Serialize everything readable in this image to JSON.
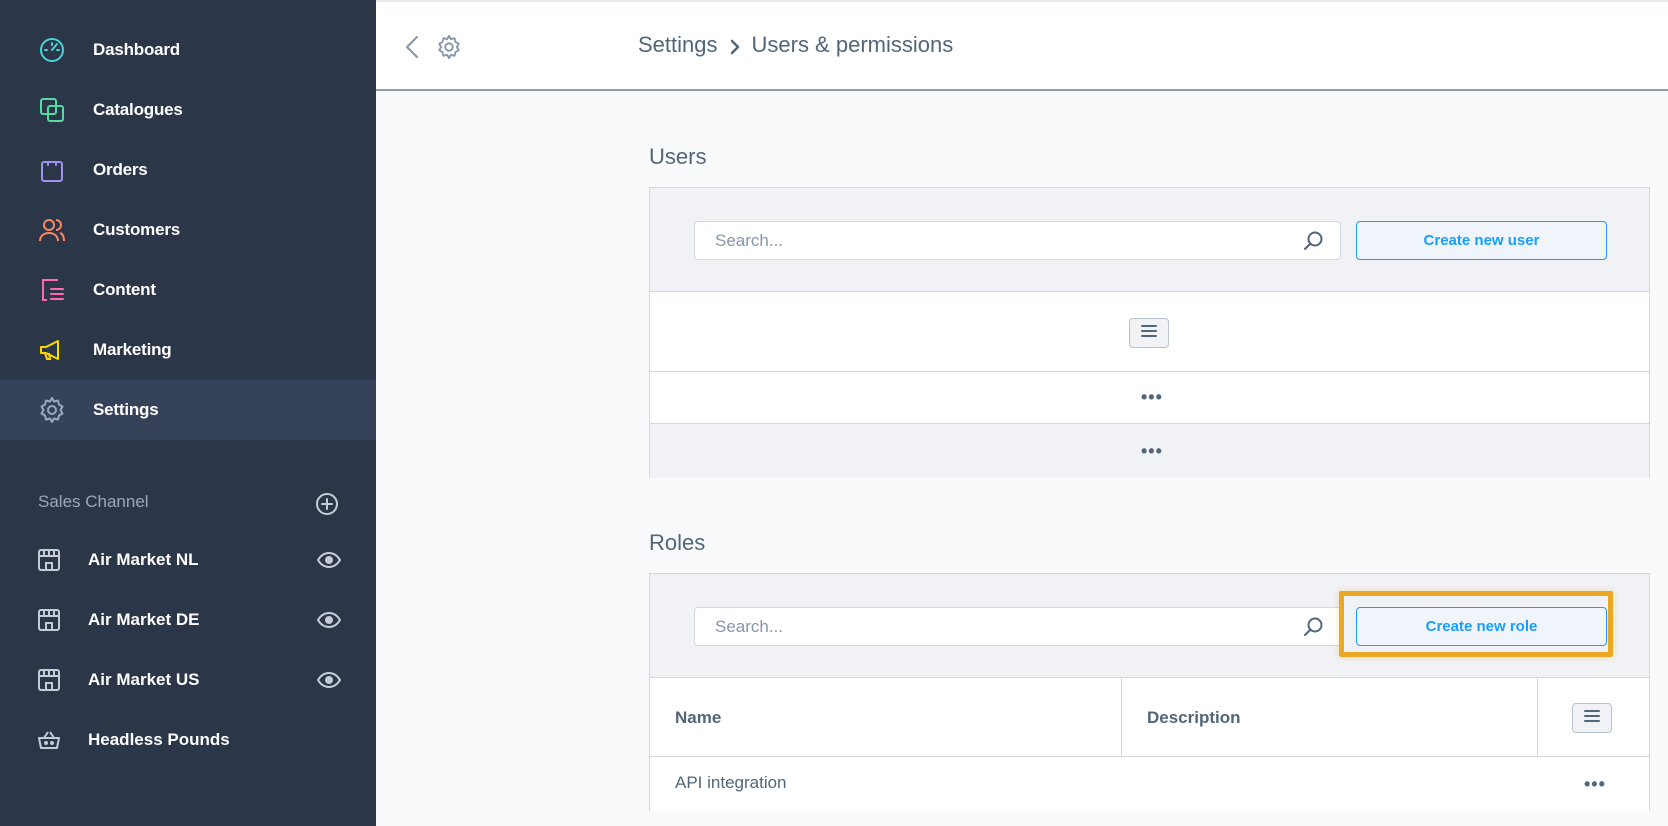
{
  "sidebar": {
    "nav": [
      {
        "label": "Dashboard",
        "icon": "dashboard-gauge-icon",
        "color": "#4fd1d9"
      },
      {
        "label": "Catalogues",
        "icon": "catalogues-icon",
        "color": "#57d9a3"
      },
      {
        "label": "Orders",
        "icon": "orders-bag-icon",
        "color": "#a092f0"
      },
      {
        "label": "Customers",
        "icon": "customers-icon",
        "color": "#f88962"
      },
      {
        "label": "Content",
        "icon": "content-icon",
        "color": "#ff68b4"
      },
      {
        "label": "Marketing",
        "icon": "marketing-megaphone-icon",
        "color": "#ffd700"
      },
      {
        "label": "Settings",
        "icon": "settings-gear-icon",
        "color": "#9aa8bd",
        "active": true
      }
    ],
    "sales_channel": {
      "title": "Sales Channel",
      "channels": [
        {
          "label": "Air Market NL",
          "icon": "storefront-icon"
        },
        {
          "label": "Air Market DE",
          "icon": "storefront-icon"
        },
        {
          "label": "Air Market US",
          "icon": "storefront-icon"
        },
        {
          "label": "Headless Pounds",
          "icon": "basket-icon"
        }
      ]
    }
  },
  "header": {
    "breadcrumb": [
      "Settings",
      "Users & permissions"
    ]
  },
  "users": {
    "title": "Users",
    "search_placeholder": "Search...",
    "create_label": "Create new user",
    "rows": [
      "•••",
      "•••"
    ]
  },
  "roles": {
    "title": "Roles",
    "search_placeholder": "Search...",
    "create_label": "Create new role",
    "columns": [
      "Name",
      "Description"
    ],
    "rows": [
      {
        "name": "API integration",
        "description": "",
        "actions": "•••"
      }
    ]
  },
  "colors": {
    "sidebar_bg": "#2b3649",
    "accent": "#189eff",
    "highlight": "#eaa824"
  }
}
